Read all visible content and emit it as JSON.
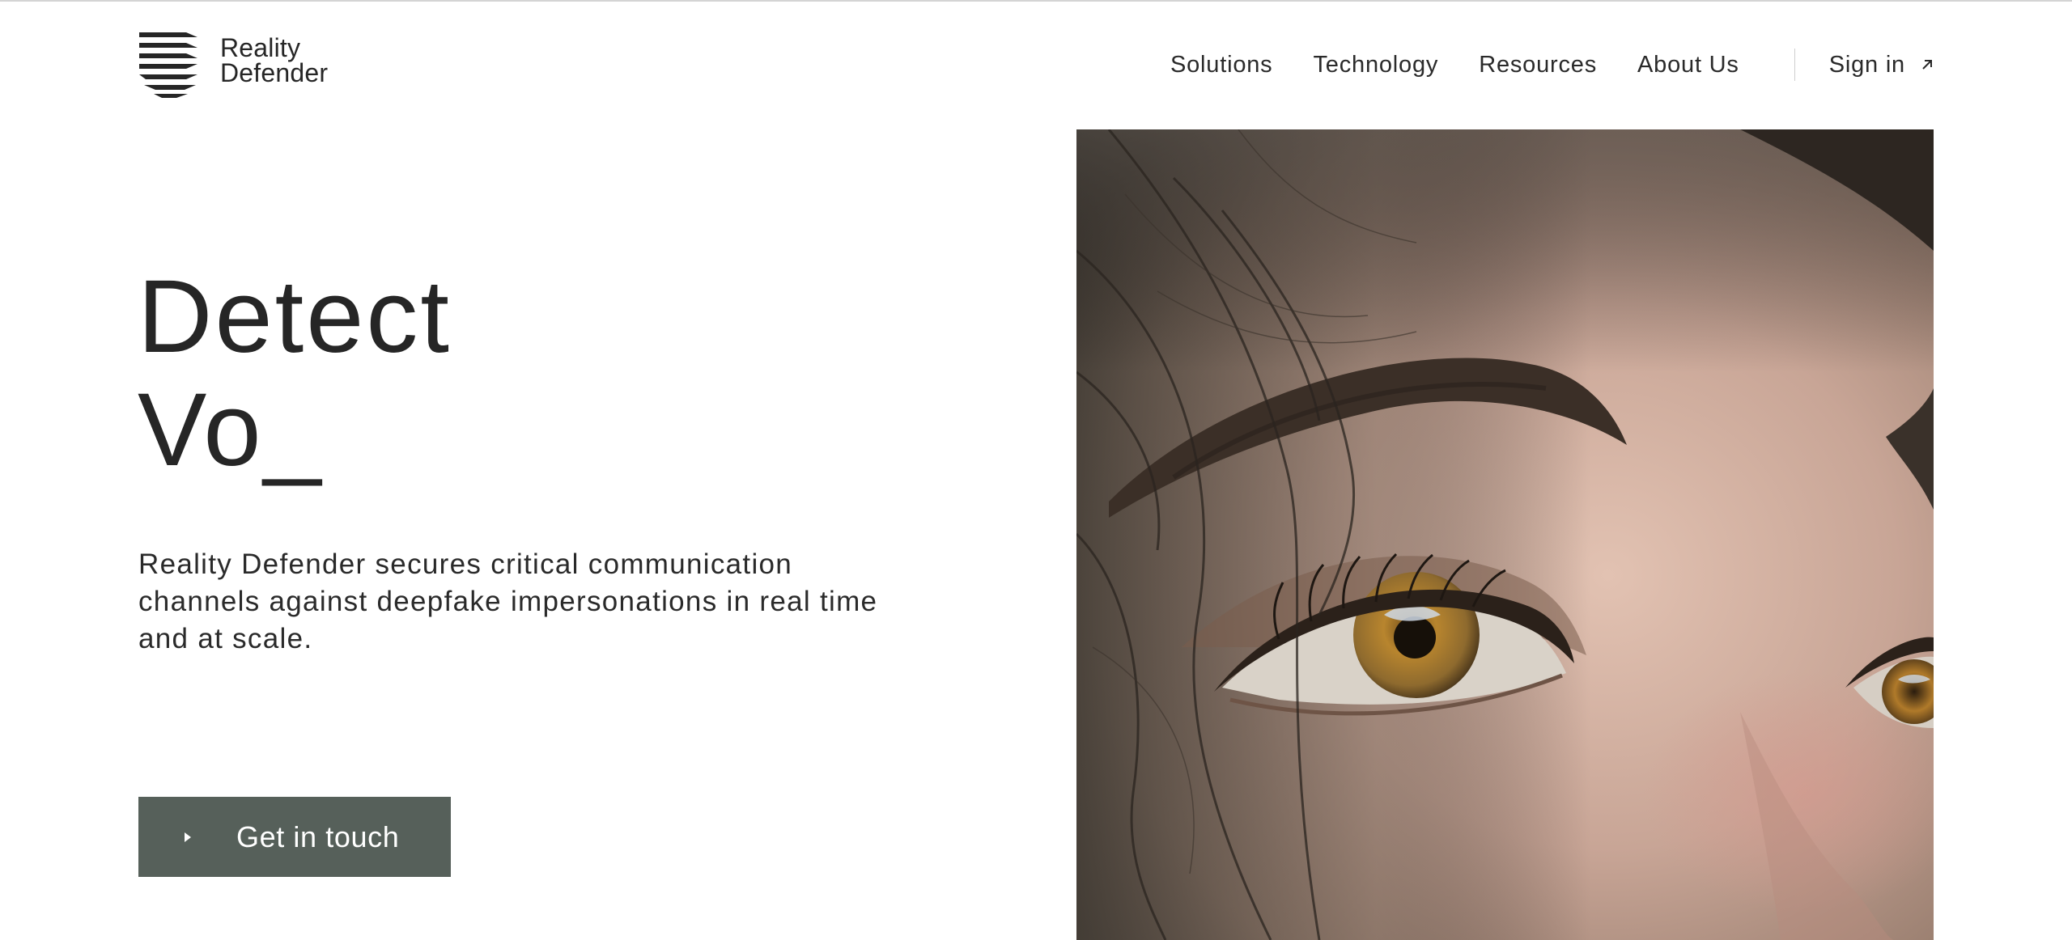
{
  "brand": {
    "name_line1": "Reality",
    "name_line2": "Defender",
    "logo_icon": "reality-defender-stripes-logo"
  },
  "nav": {
    "items": [
      {
        "label": "Solutions"
      },
      {
        "label": "Technology"
      },
      {
        "label": "Resources"
      },
      {
        "label": "About Us"
      }
    ],
    "signin_label": "Sign in",
    "signin_icon": "arrow-up-right-icon"
  },
  "hero": {
    "title_line1": "Detect",
    "title_line2": "Vo_",
    "description": "Reality Defender secures critical communication channels against deepfake impersonations in real time and at scale.",
    "cta_label": "Get in touch",
    "cta_icon": "play-triangle-icon",
    "image_subject": "close-up-eye-photo"
  },
  "colors": {
    "text": "#262626",
    "cta_background": "#56605a",
    "cta_text": "#ffffff",
    "background": "#ffffff",
    "divider": "#cfcfcf"
  }
}
